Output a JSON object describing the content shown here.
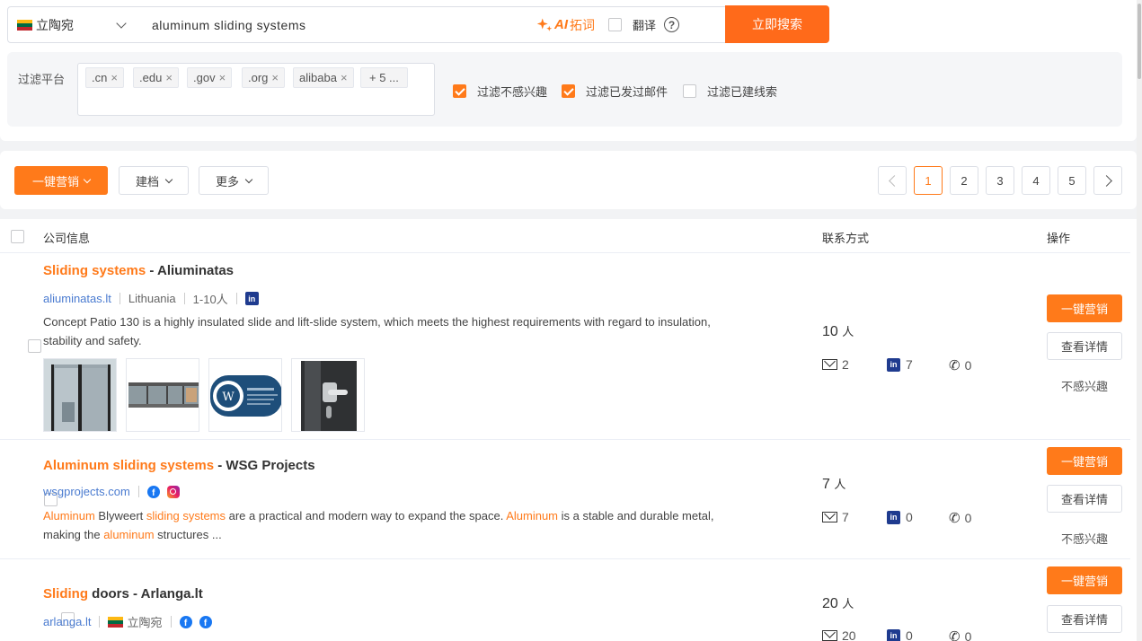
{
  "search": {
    "country": "立陶宛",
    "query": "aluminum sliding systems",
    "ai_label_prefix": "AI",
    "ai_label_suffix": "拓词",
    "translate_label": "翻译",
    "help": "?",
    "search_button": "立即搜索"
  },
  "filter": {
    "label": "过滤平台",
    "tags": [
      ".cn",
      ".edu",
      ".gov",
      ".org",
      "alibaba"
    ],
    "more_tag": "+ 5 ...",
    "tag_close": "×",
    "options": [
      {
        "label": "过滤不感兴趣",
        "checked": true
      },
      {
        "label": "过滤已发过邮件",
        "checked": true
      },
      {
        "label": "过滤已建线索",
        "checked": false
      }
    ]
  },
  "toolbar": {
    "marketing": "一键营销",
    "archive": "建档",
    "more": "更多",
    "pages": [
      "1",
      "2",
      "3",
      "4",
      "5"
    ],
    "current_page": "1"
  },
  "table": {
    "headers": {
      "company": "公司信息",
      "contact": "联系方式",
      "ops": "操作"
    },
    "rows": [
      {
        "title_hl": "Sliding systems",
        "title_rest": " - Aliuminatas",
        "domain": "aliuminatas.lt",
        "country": "Lithuania",
        "size": "1-10人",
        "desc": "Concept Patio 130 is a highly insulated slide and lift-slide system, which meets the highest requirements with regard to insulation, stability and safety.",
        "people": "10",
        "people_unit": "人",
        "emails": "2",
        "linkedin": "7",
        "phones": "0"
      },
      {
        "title_hl": "Aluminum sliding systems",
        "title_rest": " - WSG Projects",
        "domain": "wsgprojects.com",
        "desc_parts": [
          "Aluminum",
          " Blyweert ",
          "sliding systems",
          " are a practical and modern way to expand the space. ",
          "Aluminum",
          " is a stable and durable metal, making the ",
          "aluminum",
          " structures ..."
        ],
        "people": "7",
        "people_unit": "人",
        "emails": "7",
        "linkedin": "0",
        "phones": "0"
      },
      {
        "title_hl": "Sliding",
        "title_rest": " doors - Arlanga.lt",
        "domain": "arlanga.lt",
        "country": "立陶宛",
        "people": "20",
        "people_unit": "人",
        "emails": "20",
        "linkedin": "0",
        "phones": "0"
      }
    ],
    "ops": {
      "marketing": "一键营销",
      "details": "查看详情",
      "not_interested": "不感兴趣"
    }
  },
  "colors": {
    "accent": "#ff7a1a",
    "link": "#4a7bd0",
    "linkedin": "#1f3b8f",
    "facebook": "#1877f2"
  },
  "icons": [
    "flag-lithuania-icon",
    "chevron-down-icon",
    "sparkle-icon",
    "help-icon",
    "close-icon",
    "checkbox-icon",
    "linkedin-icon",
    "facebook-icon",
    "instagram-icon",
    "mail-icon",
    "phone-icon",
    "chevron-left-icon",
    "chevron-right-icon"
  ]
}
